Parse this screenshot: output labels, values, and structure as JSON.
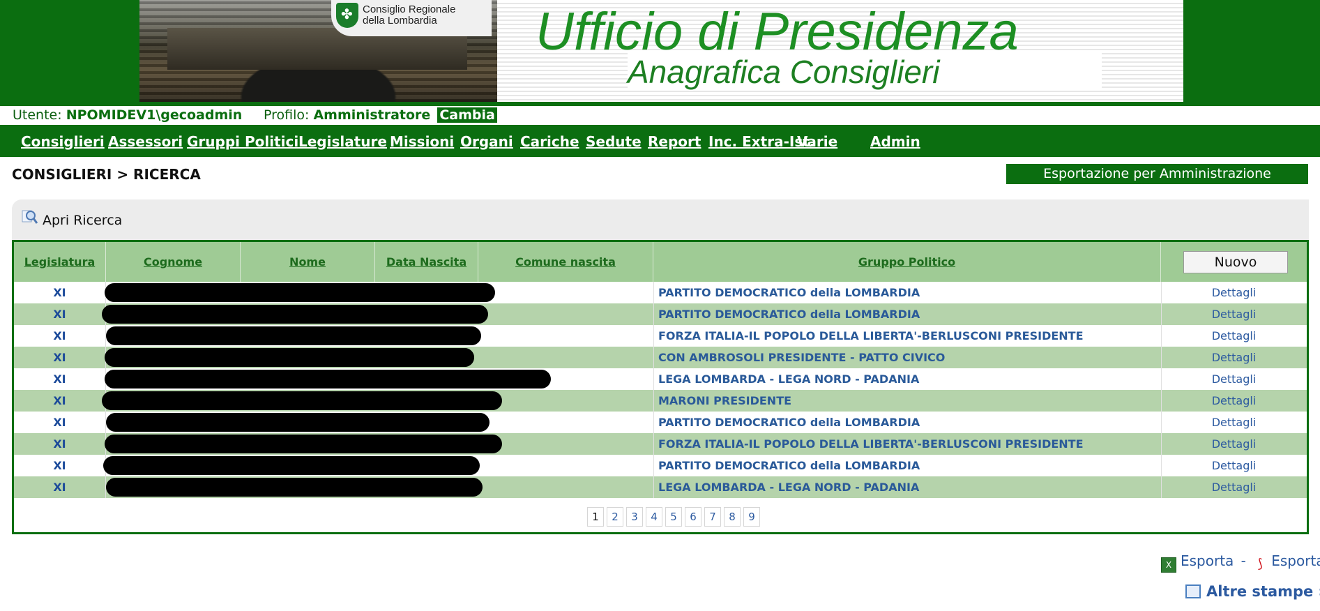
{
  "banner": {
    "logo_line1": "Consiglio Regionale",
    "logo_line2": "della Lombardia",
    "title": "Ufficio di Presidenza",
    "subtitle": "Anagrafica Consiglieri"
  },
  "userbar": {
    "user_label": "Utente:",
    "user_value": "NPOMIDEV1\\gecoadmin",
    "profile_label": "Profilo:",
    "profile_value": "Amministratore",
    "change_label": "Cambia"
  },
  "nav": [
    "Consiglieri",
    "Assessori",
    "Gruppi Politici",
    "Legislature",
    "Missioni",
    "Organi",
    "Cariche",
    "Sedute",
    "Report",
    "Inc. Extra-Ist.",
    "Varie",
    "Admin"
  ],
  "breadcrumb": "CONSIGLIERI > RICERCA",
  "export_trasparente": "Esportazione per Amministrazione Trasparente",
  "search": {
    "label": "Apri Ricerca",
    "icon": "search-icon"
  },
  "table": {
    "headers": [
      "Legislatura",
      "Cognome",
      "Nome",
      "Data Nascita",
      "Comune nascita",
      "Gruppo Politico"
    ],
    "new_button": "Nuovo",
    "rows": [
      {
        "legislatura": "XI",
        "gruppo": "PARTITO DEMOCRATICO della LOMBARDIA",
        "action": "Dettagli"
      },
      {
        "legislatura": "XI",
        "gruppo": "PARTITO DEMOCRATICO della LOMBARDIA",
        "action": "Dettagli"
      },
      {
        "legislatura": "XI",
        "gruppo": "FORZA ITALIA-IL POPOLO DELLA LIBERTA'-BERLUSCONI PRESIDENTE",
        "action": "Dettagli"
      },
      {
        "legislatura": "XI",
        "gruppo": "CON AMBROSOLI PRESIDENTE - PATTO CIVICO",
        "action": "Dettagli"
      },
      {
        "legislatura": "XI",
        "gruppo": "LEGA LOMBARDA - LEGA NORD - PADANIA",
        "action": "Dettagli"
      },
      {
        "legislatura": "XI",
        "gruppo": "MARONI PRESIDENTE",
        "action": "Dettagli"
      },
      {
        "legislatura": "XI",
        "gruppo": "PARTITO DEMOCRATICO della LOMBARDIA",
        "action": "Dettagli"
      },
      {
        "legislatura": "XI",
        "gruppo": "FORZA ITALIA-IL POPOLO DELLA LIBERTA'-BERLUSCONI PRESIDENTE",
        "action": "Dettagli"
      },
      {
        "legislatura": "XI",
        "gruppo": "PARTITO DEMOCRATICO della LOMBARDIA",
        "action": "Dettagli"
      },
      {
        "legislatura": "XI",
        "gruppo": "LEGA LOMBARDA - LEGA NORD - PADANIA",
        "action": "Dettagli"
      }
    ]
  },
  "pagination": {
    "pages": [
      "1",
      "2",
      "3",
      "4",
      "5",
      "6",
      "7",
      "8",
      "9"
    ],
    "current": "1"
  },
  "footer": {
    "export_xls": "Esporta",
    "separator": "-",
    "export_pdf": "Esporta",
    "more_prints": "Altre stampe »"
  },
  "colors": {
    "brand_green": "#0b6e10",
    "header_green": "#9fcb95",
    "row_alt": "#b5d3ab",
    "link_blue": "#2c5aa0"
  }
}
